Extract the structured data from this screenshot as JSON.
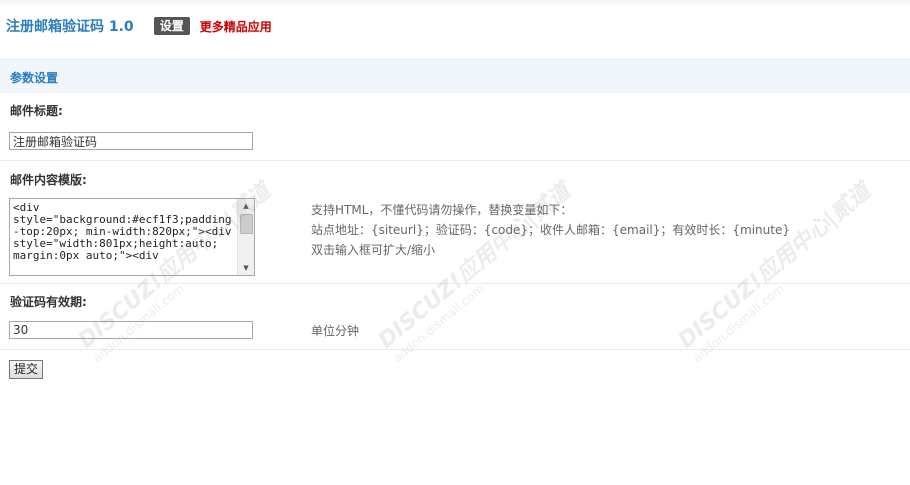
{
  "header": {
    "app_title": "注册邮箱验证码 1.0",
    "settings_tab": "设置",
    "more_apps_link": "更多精品应用"
  },
  "section": {
    "title": "参数设置"
  },
  "fields": {
    "mail_subject": {
      "label": "邮件标题:",
      "value": "注册邮箱验证码"
    },
    "mail_template": {
      "label": "邮件内容模版:",
      "value": "<div style=\"background:#ecf1f3;padding-top:20px; min-width:820px;\"><div style=\"width:801px;height:auto; margin:0px auto;\"><div",
      "hint_lines": [
        "支持HTML，不懂代码请勿操作，替换变量如下：",
        "站点地址：{siteurl}；验证码：{code}；收件人邮箱：{email}；有效时长：{minute}",
        "双击输入框可扩大/缩小"
      ]
    },
    "code_validity": {
      "label": "验证码有效期:",
      "value": "30",
      "hint": "单位分钟"
    }
  },
  "submit_label": "提交",
  "watermark": {
    "brand": "DISCUZ!应用中心|贰道",
    "url": "addon.dismall.com"
  },
  "colors": {
    "title_blue": "#2b7dbc",
    "link_red": "#d00000",
    "section_bg": "#f0f6fb"
  }
}
